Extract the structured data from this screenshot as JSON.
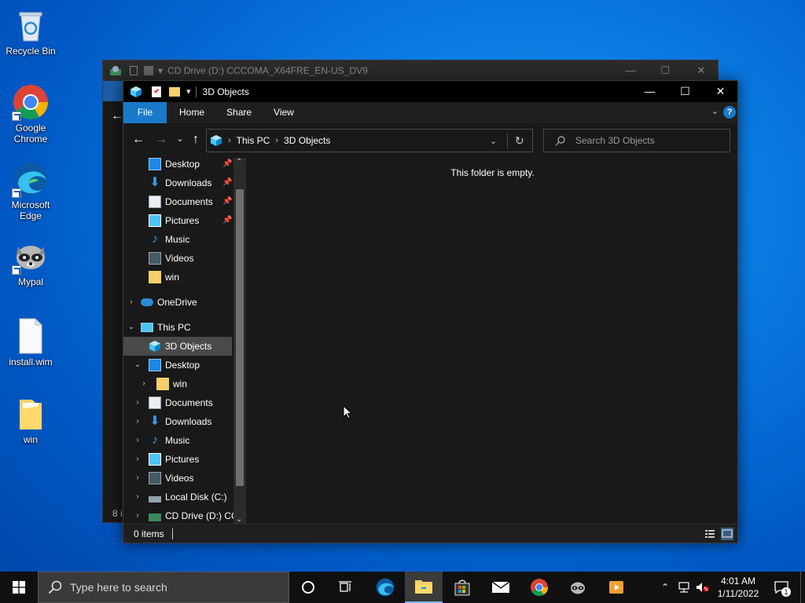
{
  "desktop": {
    "icons": [
      {
        "label": "Recycle Bin"
      },
      {
        "label": "Google Chrome"
      },
      {
        "label": "Microsoft Edge"
      },
      {
        "label": "Mypal"
      },
      {
        "label": "install.wim"
      },
      {
        "label": "win"
      }
    ]
  },
  "background_window": {
    "title": "CD Drive (D:) CCCOMA_X64FRE_EN-US_DV9",
    "status": "8 i"
  },
  "window": {
    "title": "3D Objects",
    "ribbon_tabs": [
      "File",
      "Home",
      "Share",
      "View"
    ],
    "address": {
      "crumbs": [
        "This PC",
        "3D Objects"
      ]
    },
    "search_placeholder": "Search 3D Objects",
    "nav": {
      "quick_access": [
        {
          "label": "Desktop",
          "pinned": true
        },
        {
          "label": "Downloads",
          "pinned": true
        },
        {
          "label": "Documents",
          "pinned": true
        },
        {
          "label": "Pictures",
          "pinned": true
        },
        {
          "label": "Music",
          "pinned": false
        },
        {
          "label": "Videos",
          "pinned": false
        },
        {
          "label": "win",
          "pinned": false
        }
      ],
      "onedrive": "OneDrive",
      "this_pc": "This PC",
      "this_pc_items": [
        {
          "label": "3D Objects",
          "selected": true
        },
        {
          "label": "Desktop"
        },
        {
          "label": "win"
        },
        {
          "label": "Documents"
        },
        {
          "label": "Downloads"
        },
        {
          "label": "Music"
        },
        {
          "label": "Pictures"
        },
        {
          "label": "Videos"
        },
        {
          "label": "Local Disk (C:)"
        },
        {
          "label": "CD Drive (D:) CC"
        }
      ]
    },
    "empty_message": "This folder is empty.",
    "status": {
      "items": "0 items"
    }
  },
  "taskbar": {
    "search_placeholder": "Type here to search",
    "clock": {
      "time": "4:01 AM",
      "date": "1/11/2022"
    },
    "notifications": "1"
  },
  "colors": {
    "accent": "#1979ca",
    "window_bg": "#191919",
    "titlebar": "#000000"
  }
}
